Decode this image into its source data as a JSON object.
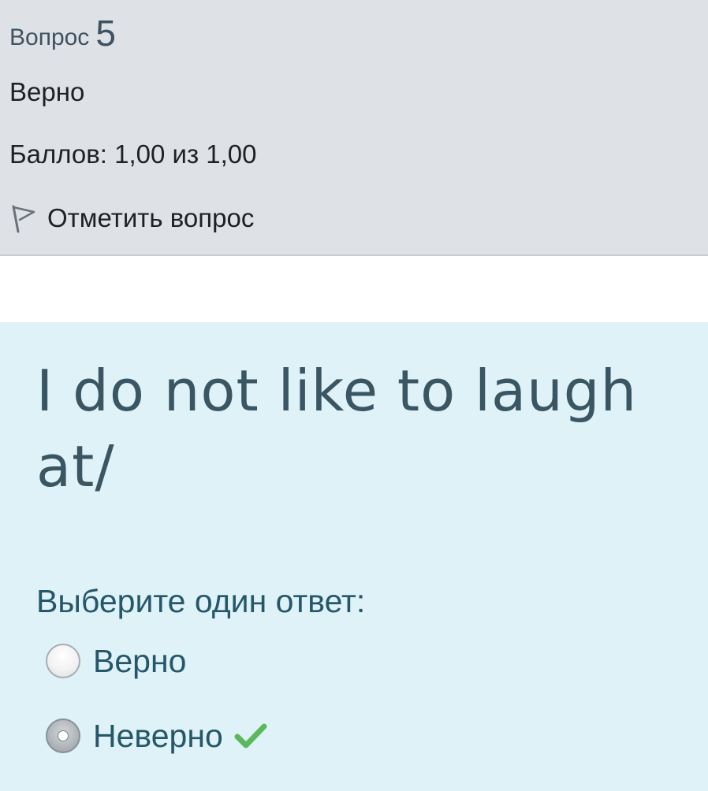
{
  "question_info": {
    "heading_word": "Вопрос",
    "number": "5",
    "state": "Верно",
    "grade": "Баллов: 1,00 из 1,00",
    "flag_label": "Отметить вопрос"
  },
  "question": {
    "text": "I do not like to laugh at/",
    "prompt": "Выберите один ответ:",
    "answers": [
      {
        "label": "Верно",
        "selected": false
      },
      {
        "label": "Неверно",
        "selected": true,
        "correct": true
      }
    ]
  },
  "colors": {
    "info_background": "#dee2e6",
    "content_background": "#def2f8",
    "correct_check": "#5cb85c"
  },
  "icons": {
    "flag": "flag-outline-icon",
    "correct": "checkmark-icon"
  }
}
